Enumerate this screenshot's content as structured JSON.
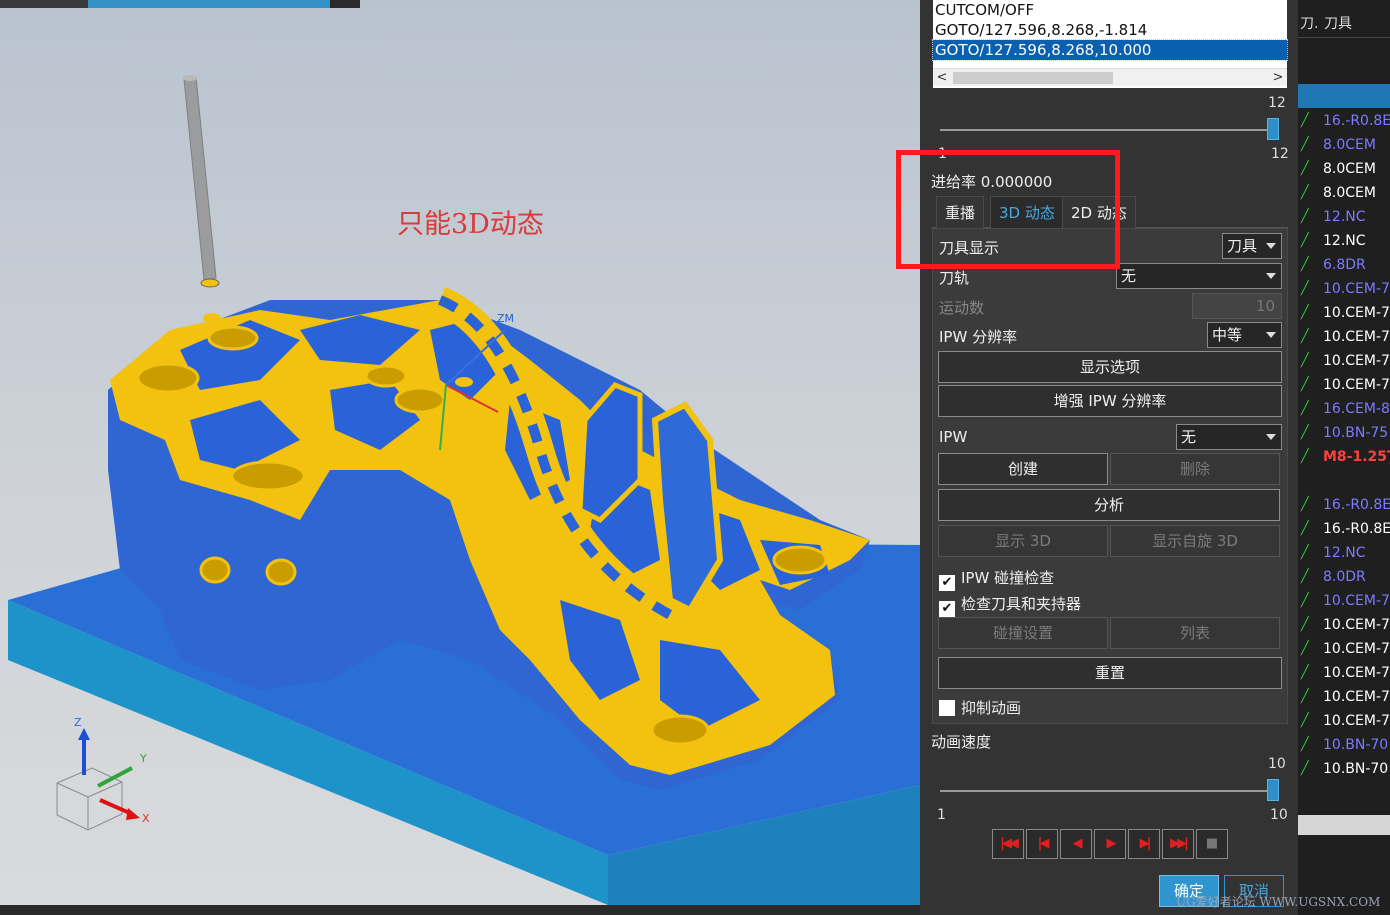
{
  "annotation": "只能3D动态",
  "axis_labels": {
    "zm": "ZM",
    "z": "Z",
    "y": "Y",
    "x": "X"
  },
  "code_lines": [
    {
      "text": "CUTCOM/OFF",
      "selected": false
    },
    {
      "text": "GOTO/127.596,8.268,-1.814",
      "selected": false
    },
    {
      "text": "GOTO/127.596,8.268,10.000",
      "selected": true
    }
  ],
  "scroll_arrows": {
    "left": "<",
    "right": ">"
  },
  "step_slider": {
    "max_label": "12",
    "value_label": "12",
    "min_label": "1",
    "value": 12,
    "max": 12
  },
  "feed_rate_label": "进给率 0.000000",
  "tabs": [
    {
      "label": "重播",
      "active": false
    },
    {
      "label": "3D 动态",
      "active": true
    },
    {
      "label": "2D 动态",
      "active": false
    }
  ],
  "tool_display": {
    "label": "刀具显示",
    "value": "刀具"
  },
  "toolpath": {
    "label": "刀轨",
    "value": "无"
  },
  "motion_count": {
    "label": "运动数",
    "value": "10"
  },
  "ipw_resolution": {
    "label": "IPW 分辨率",
    "value": "中等"
  },
  "buttons": {
    "display_options": "显示选项",
    "enhance_ipw": "增强 IPW 分辨率",
    "create": "创建",
    "delete": "删除",
    "analyze": "分析",
    "show_3d": "显示 3D",
    "show_spin_3d": "显示自旋 3D",
    "collision_settings": "碰撞设置",
    "list": "列表",
    "reset": "重置",
    "ok": "确定",
    "cancel": "取消"
  },
  "ipw": {
    "label": "IPW",
    "value": "无"
  },
  "checkboxes": {
    "ipw_collision": {
      "label": "IPW 碰撞检查",
      "checked": true
    },
    "check_holder": {
      "label": "检查刀具和夹持器",
      "checked": true
    },
    "suppress_animation": {
      "label": "抑制动画",
      "checked": false
    }
  },
  "animation_speed": {
    "label": "动画速度",
    "max_label": "10",
    "min_label": "1",
    "value_label": "10",
    "value": 10,
    "max": 10
  },
  "transport_icons": [
    "rewind-to-start-icon",
    "step-back-icon",
    "play-reverse-icon",
    "play-forward-icon",
    "step-forward-icon",
    "fast-forward-icon",
    "stop-icon"
  ],
  "tool_list": {
    "headers": [
      "刀.",
      "刀具"
    ],
    "rows": [
      {
        "name": "16.-R0.8E",
        "color": "#7b7bff"
      },
      {
        "name": "8.0CEM",
        "color": "#7b7bff"
      },
      {
        "name": "8.0CEM",
        "color": "#ffffff"
      },
      {
        "name": "8.0CEM",
        "color": "#ffffff"
      },
      {
        "name": "12.NC",
        "color": "#7b7bff"
      },
      {
        "name": "12.NC",
        "color": "#ffffff"
      },
      {
        "name": "6.8DR",
        "color": "#7b7bff"
      },
      {
        "name": "10.CEM-7",
        "color": "#7b7bff"
      },
      {
        "name": "10.CEM-7",
        "color": "#ffffff"
      },
      {
        "name": "10.CEM-7",
        "color": "#ffffff"
      },
      {
        "name": "10.CEM-7",
        "color": "#ffffff"
      },
      {
        "name": "10.CEM-7",
        "color": "#ffffff"
      },
      {
        "name": "16.CEM-8",
        "color": "#7b7bff"
      },
      {
        "name": "10.BN-75",
        "color": "#7b7bff"
      },
      {
        "name": "M8-1.25T",
        "color": "#ff4040"
      },
      {
        "name": "",
        "color": "#ffffff"
      },
      {
        "name": "16.-R0.8E",
        "color": "#7b7bff"
      },
      {
        "name": "16.-R0.8E",
        "color": "#ffffff"
      },
      {
        "name": "12.NC",
        "color": "#7b7bff"
      },
      {
        "name": "8.0DR",
        "color": "#7b7bff"
      },
      {
        "name": "10.CEM-7",
        "color": "#7b7bff"
      },
      {
        "name": "10.CEM-7",
        "color": "#ffffff"
      },
      {
        "name": "10.CEM-7",
        "color": "#ffffff"
      },
      {
        "name": "10.CEM-7",
        "color": "#ffffff"
      },
      {
        "name": "10.CEM-7",
        "color": "#ffffff"
      },
      {
        "name": "10.CEM-7",
        "color": "#ffffff"
      },
      {
        "name": "10.BN-70",
        "color": "#7b7bff"
      },
      {
        "name": "10.BN-70",
        "color": "#ffffff"
      }
    ]
  },
  "watermark": "UG爱好者论坛 WWW.UGSNX.COM",
  "colors": {
    "accent": "#2e95cf",
    "stock": "#2a6fd6",
    "machined": "#f2c20f",
    "highlight": "#ff1b1b"
  }
}
